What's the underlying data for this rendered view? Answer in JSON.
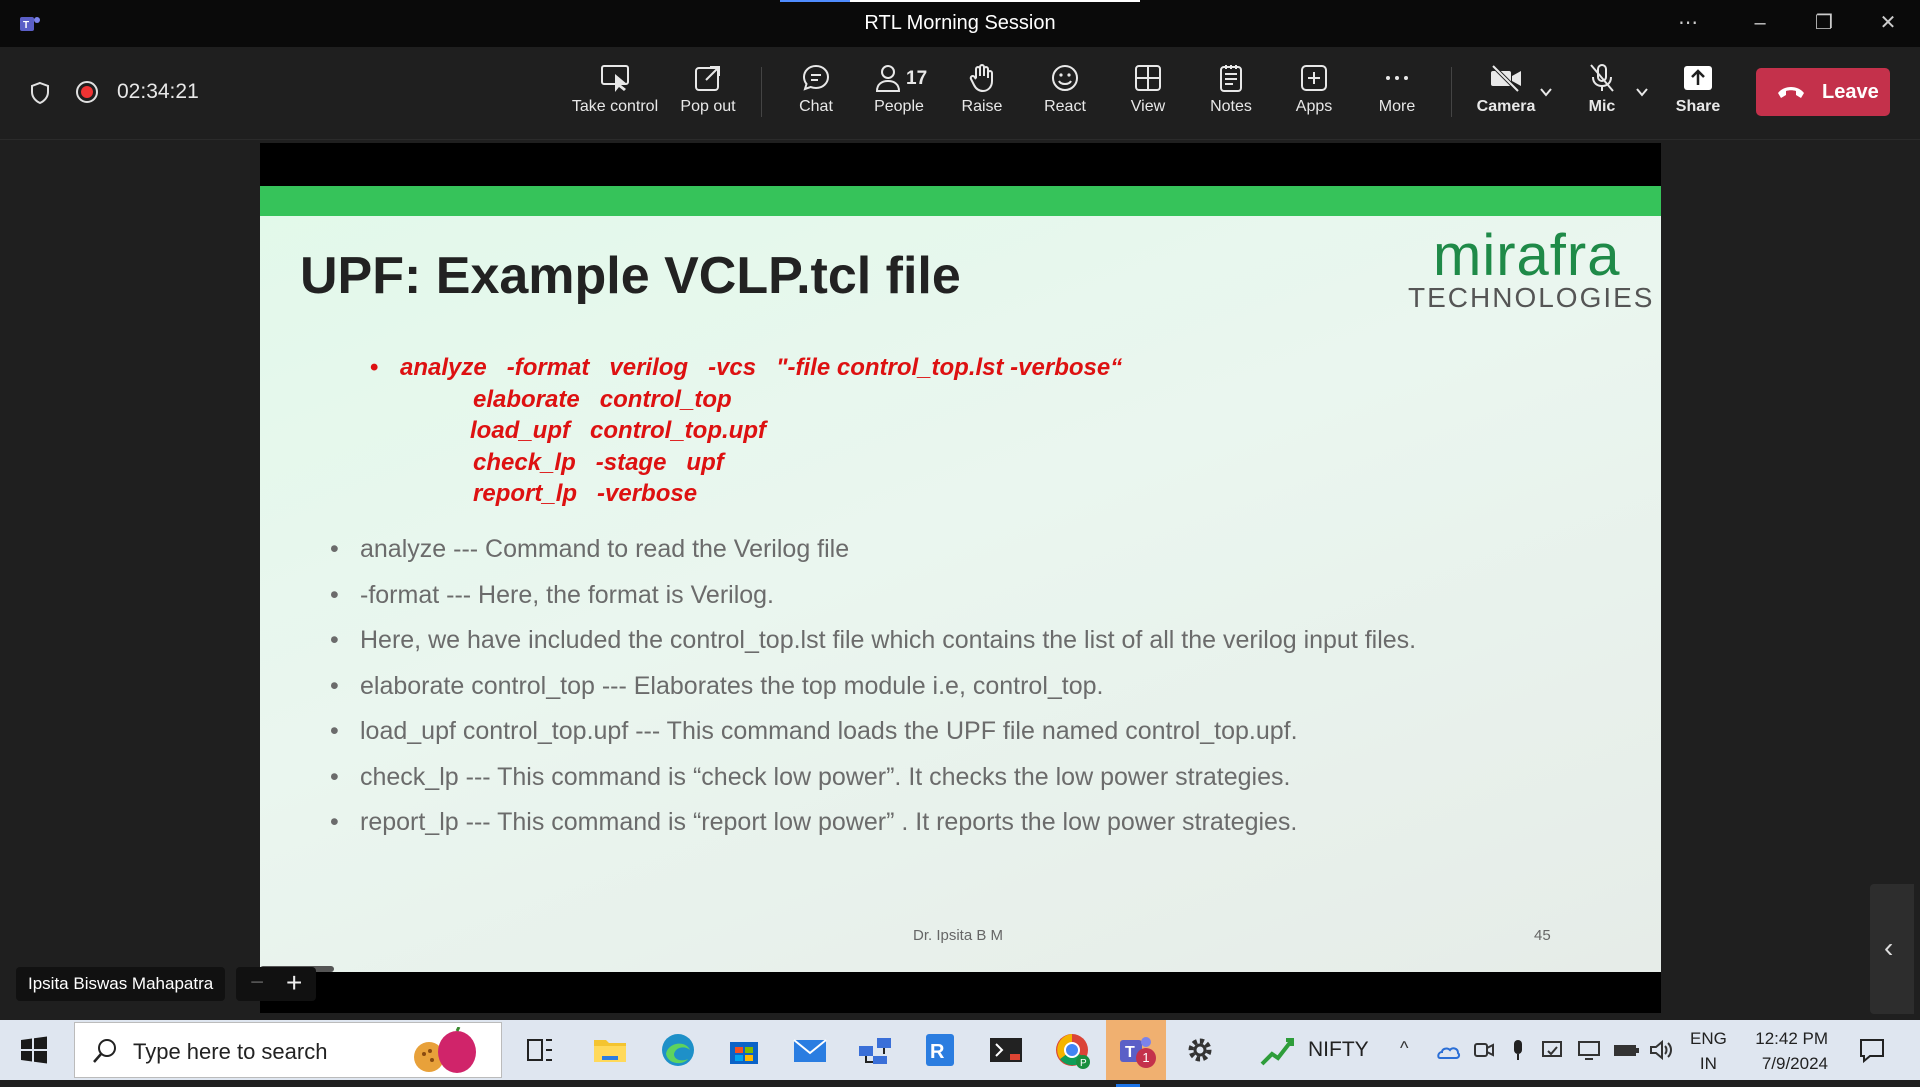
{
  "window": {
    "title": "RTL Morning Session"
  },
  "meeting": {
    "timer": "02:34:21"
  },
  "toolbar": {
    "take_control": "Take control",
    "pop_out": "Pop out",
    "chat": "Chat",
    "people": "People",
    "people_count": "17",
    "raise": "Raise",
    "react": "React",
    "view": "View",
    "notes": "Notes",
    "apps": "Apps",
    "more": "More",
    "camera": "Camera",
    "mic": "Mic",
    "share": "Share",
    "leave": "Leave"
  },
  "slide": {
    "title": "UPF: Example VCLP.tcl file",
    "logo_word": "mirafra",
    "logo_sub": "TECHNOLOGIES",
    "code_lines": [
      "analyze   -format   verilog   -vcs   \"-file control_top.lst -verbose“",
      "elaborate   control_top",
      "load_upf   control_top.upf",
      "check_lp   -stage   upf",
      "report_lp   -verbose"
    ],
    "bullets": [
      "analyze --- Command to read the Verilog file",
      "-format --- Here, the format is Verilog.",
      "Here, we have included the control_top.lst file which contains the list of all the verilog input files.",
      "elaborate control_top --- Elaborates the top module i.e, control_top.",
      "load_upf control_top.upf --- This command loads the UPF file named control_top.upf.",
      "check_lp --- This command is “check low power”. It checks the low power strategies.",
      "report_lp --- This command is “report low power” . It reports the low power strategies."
    ],
    "footer_name": "Dr. Ipsita B M",
    "page_number": "45"
  },
  "presenter": {
    "name": "Ipsita Biswas Mahapatra"
  },
  "taskbar": {
    "search_placeholder": "Type here to search",
    "nifty_label": "NIFTY",
    "lang_top": "ENG",
    "lang_bottom": "IN",
    "time": "12:42 PM",
    "date": "7/9/2024",
    "teams_badge": "1"
  },
  "colors": {
    "leave": "#c4314b",
    "slide_bar": "#36c35a",
    "code_text": "#dd1111",
    "logo": "#1f8a48"
  }
}
